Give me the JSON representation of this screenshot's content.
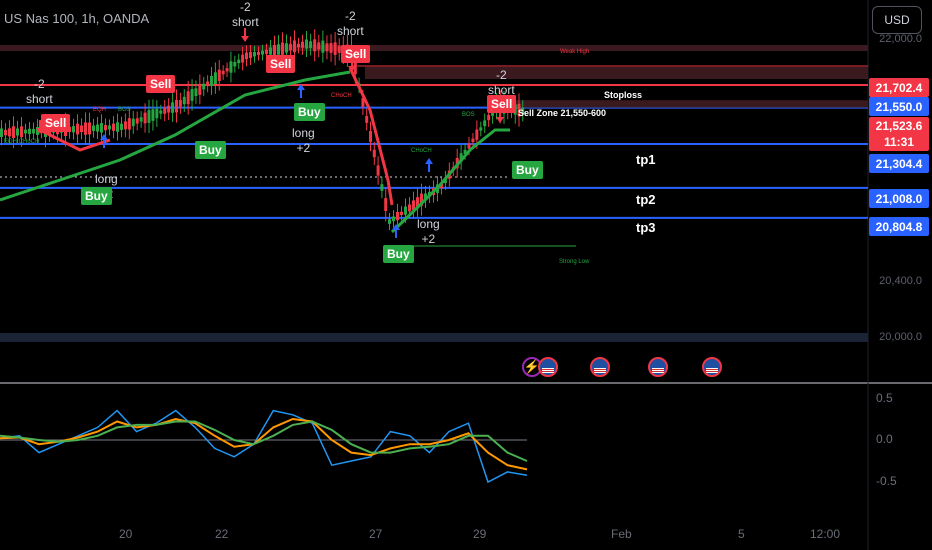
{
  "header": {
    "symbol": "US Nas 100, 1h, OANDA",
    "currency": "USD"
  },
  "price_axis": {
    "grey_ticks": [
      "22,000.0",
      "20,400.0",
      "20,000.0"
    ],
    "labels": [
      {
        "text": "21,702.4",
        "color": "#f23645"
      },
      {
        "text": "21,550.0",
        "color": "#2962ff"
      },
      {
        "text": "21,523.6",
        "sub": "11:31",
        "color": "#f23645"
      },
      {
        "text": "21,304.4",
        "color": "#2962ff"
      },
      {
        "text": "21,008.0",
        "color": "#2962ff"
      },
      {
        "text": "20,804.8",
        "color": "#2962ff"
      }
    ]
  },
  "levels": {
    "stoploss": "Stoploss",
    "sell_zone": "Sell Zone 21,550-600",
    "tp1": "tp1",
    "tp2": "tp2",
    "tp3": "tp3",
    "weak_high": "Weak High",
    "strong_low": "Strong Low"
  },
  "signals": {
    "sell": "Sell",
    "buy": "Buy",
    "short": [
      "-2",
      "short"
    ],
    "long": [
      "long",
      "+2"
    ],
    "structure": [
      "EQH",
      "BOS",
      "CHoCH",
      "EQH CHoCH"
    ]
  },
  "time_axis": [
    "20",
    "22",
    "27",
    "29",
    "Feb",
    "5",
    "12:00"
  ],
  "oscillator": {
    "y_ticks": [
      "0.5",
      "0.0",
      "-0.5"
    ]
  },
  "colors": {
    "bull": "#26a641",
    "bear": "#f23645",
    "level": "#2962ff",
    "fast": "#2196f3",
    "mid": "#ff9800",
    "slow": "#4caf50"
  },
  "chart_data": {
    "type": "line",
    "title": "US Nas 100, 1h, OANDA",
    "x": [
      "19",
      "20",
      "21",
      "22",
      "23",
      "24",
      "27",
      "28",
      "29",
      "30"
    ],
    "series": [
      {
        "values": [
          21380,
          21420,
          21560,
          21900,
          21980,
          21930,
          20780,
          21020,
          21560,
          21523.6
        ]
      }
    ],
    "levels": {
      "stoploss": 21702.4,
      "sell_zone": [
        21550,
        21600
      ],
      "tp1": 21304.4,
      "tp2": 21008.0,
      "tp3": 20804.8
    },
    "ylim": [
      19980,
      22080
    ]
  }
}
